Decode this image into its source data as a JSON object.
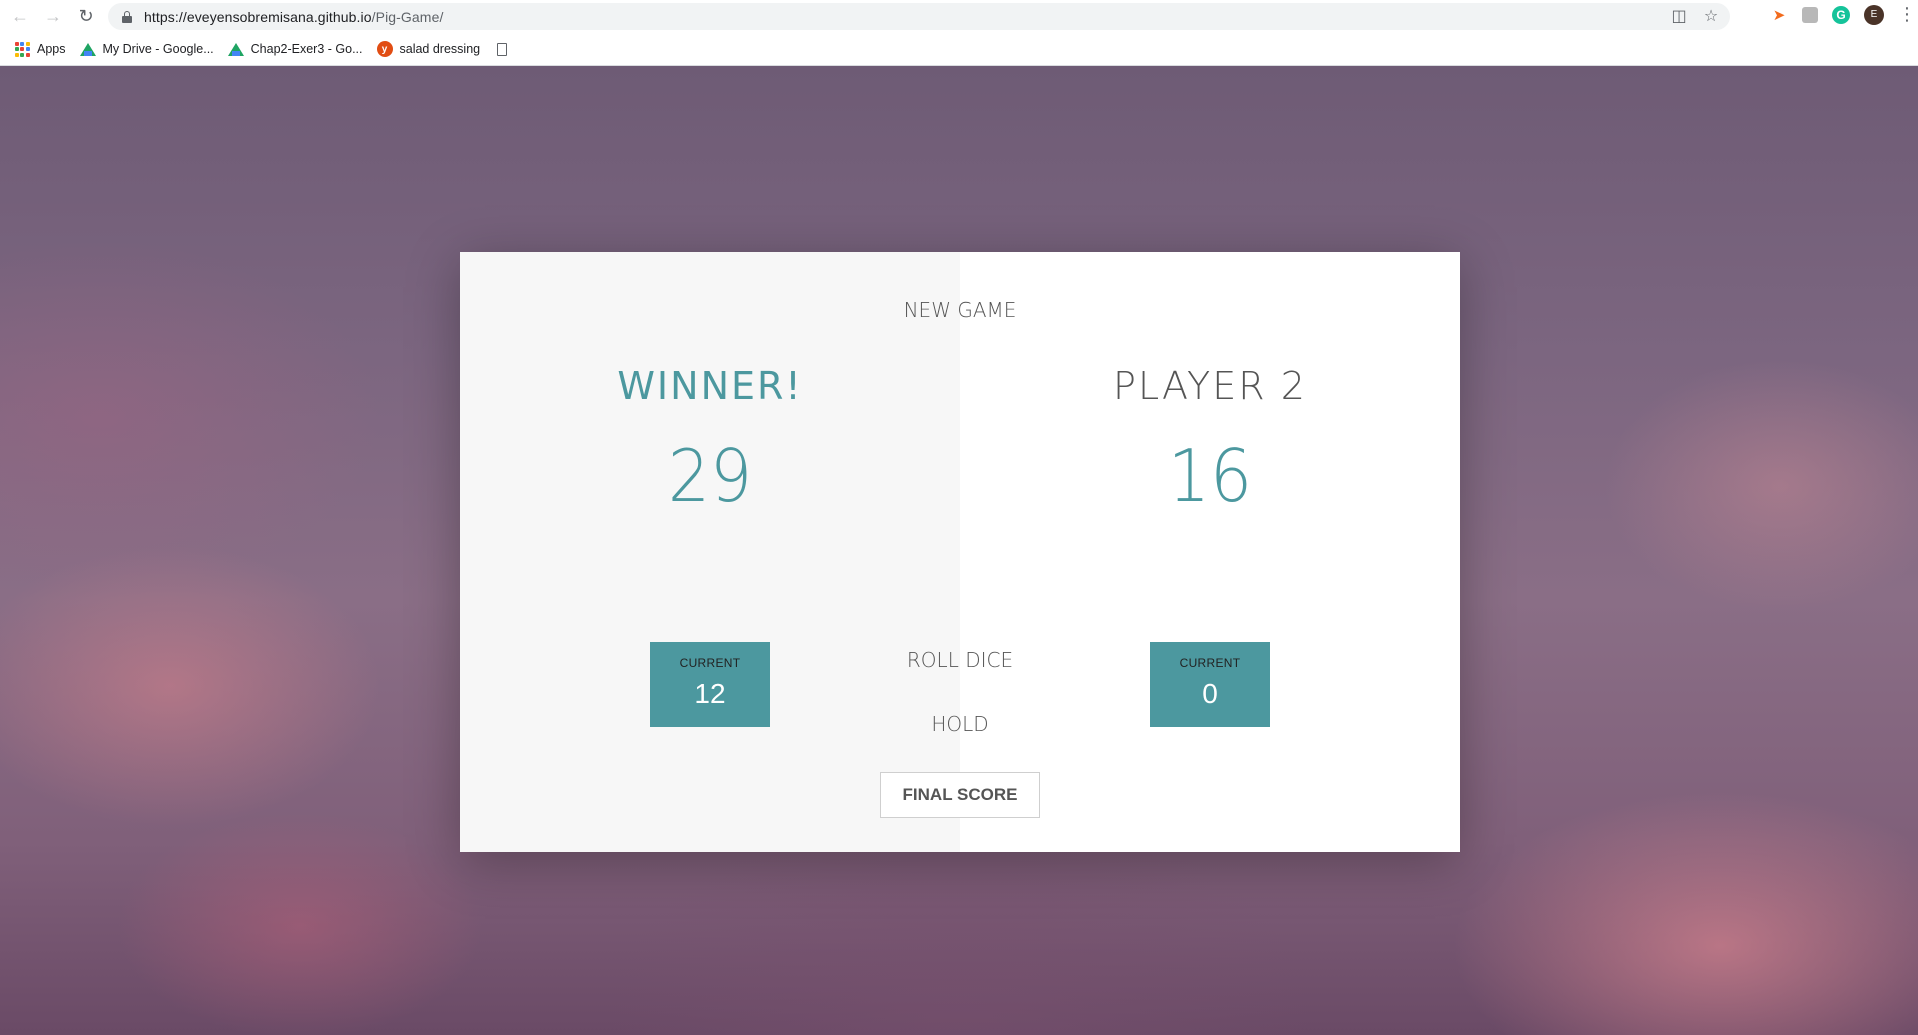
{
  "browser": {
    "url_host": "https://eveyensobremisana.github.io",
    "url_path": "/Pig-Game/",
    "avatar_letter": "E",
    "bookmarks": [
      {
        "label": "Apps",
        "icon": "apps-grid-icon"
      },
      {
        "label": "My Drive - Google...",
        "icon": "google-drive-icon"
      },
      {
        "label": "Chap2-Exer3 - Go...",
        "icon": "google-drive-icon"
      },
      {
        "label": "salad dressing",
        "icon": "yelp-icon"
      },
      {
        "label": "",
        "icon": "page-icon"
      }
    ]
  },
  "game": {
    "new_game_label": "NEW GAME",
    "roll_dice_label": "ROLL DICE",
    "hold_label": "HOLD",
    "final_score_placeholder": "FINAL SCORE",
    "players": [
      {
        "name": "WINNER!",
        "score": "29",
        "current_label": "CURRENT",
        "current_score": "12",
        "is_winner": true
      },
      {
        "name": "PLAYER 2",
        "score": "16",
        "current_label": "CURRENT",
        "current_score": "0",
        "is_winner": false
      }
    ],
    "accent_color": "#4c989f"
  }
}
